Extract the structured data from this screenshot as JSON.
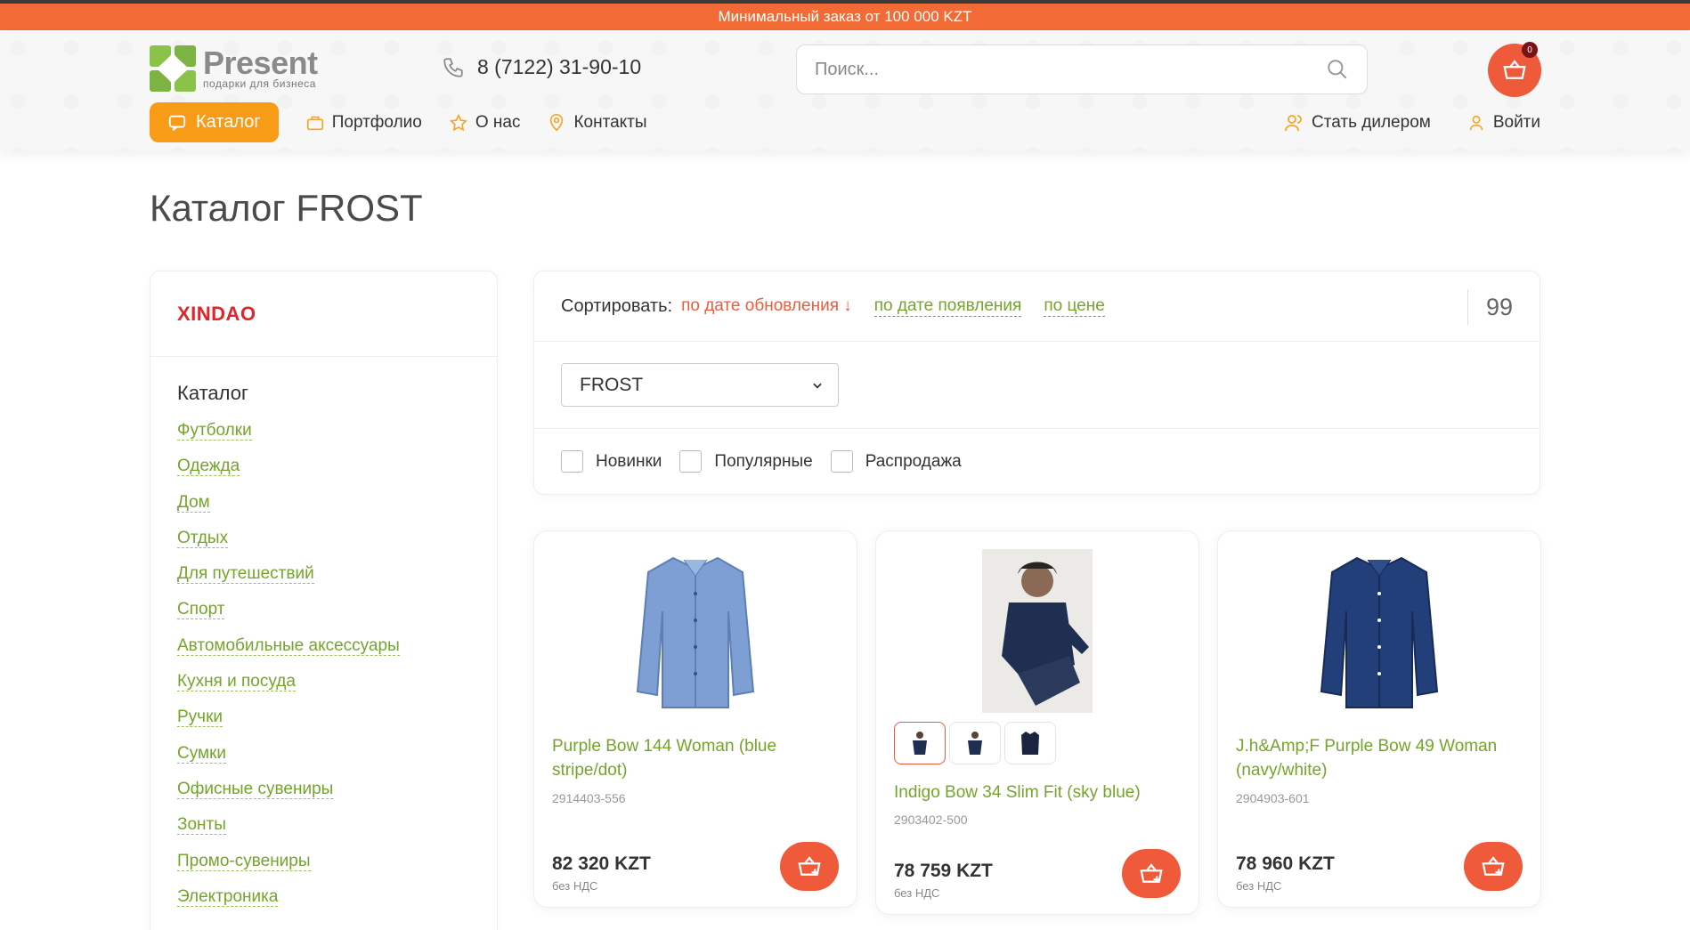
{
  "topbar": {
    "text": "Минимальный заказ от 100 000 KZT"
  },
  "header": {
    "logo_title": "Present",
    "logo_sub": "подарки для бизнеса",
    "phone": "8 (7122) 31-90-10",
    "search_placeholder": "Поиск...",
    "cart_count": "0"
  },
  "nav": {
    "catalog": "Каталог",
    "portfolio": "Портфолио",
    "about": "О нас",
    "contacts": "Контакты",
    "dealer": "Стать дилером",
    "login": "Войти"
  },
  "page": {
    "title": "Каталог FROST"
  },
  "sidebar": {
    "brand": "XINDAO",
    "catalog_title": "Каталог",
    "items": [
      "Футболки",
      "Одежда",
      "Дом",
      "Отдых",
      "Для путешествий",
      "Спорт",
      "Автомобильные аксессуары",
      "Кухня и посуда",
      "Ручки",
      "Сумки",
      "Офисные сувениры",
      "Зонты",
      "Промо-сувениры",
      "Электроника"
    ]
  },
  "filter": {
    "sort_label": "Сортировать:",
    "sort_by_update": "по дате обновления ↓",
    "sort_by_date": "по дате появления",
    "sort_by_price": "по цене",
    "count": "99",
    "brand_select": "FROST",
    "checkboxes": [
      "Новинки",
      "Популярные",
      "Распродажа"
    ]
  },
  "products": [
    {
      "name": "Purple Bow 144 Woman (blue stripe/dot)",
      "sku": "2914403-556",
      "price": "82 320 KZT",
      "vat": "без НДС",
      "color": "#7d9fd4"
    },
    {
      "name": "Indigo Bow 34 Slim Fit (sky blue)",
      "sku": "2903402-500",
      "price": "78 759 KZT",
      "vat": "без НДС",
      "color": "#1f2f52"
    },
    {
      "name": "J.h&Amp;F Purple Bow 49 Woman (navy/white)",
      "sku": "2904903-601",
      "price": "78 960 KZT",
      "vat": "без НДС",
      "color": "#233f7a"
    }
  ],
  "colors": {
    "accent": "#f26a35",
    "orange": "#f89b16",
    "green": "#74a52b",
    "red": "#ef5a3a"
  }
}
